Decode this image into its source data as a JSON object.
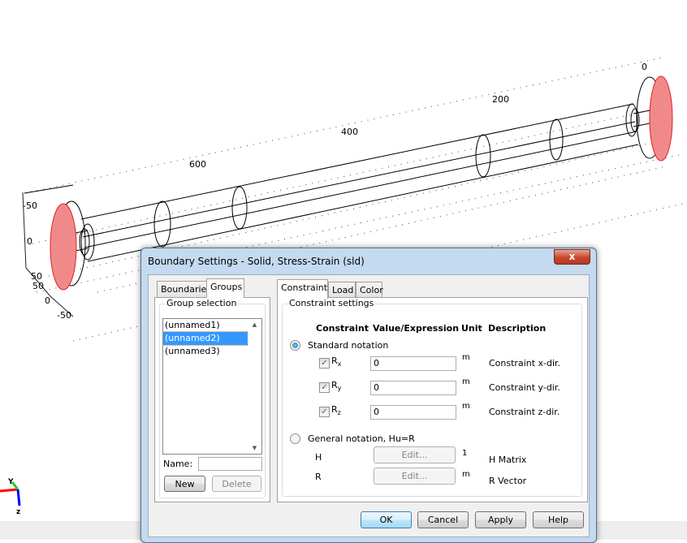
{
  "scene": {
    "axis_labels_top": [
      "0",
      "200",
      "400",
      "600"
    ],
    "axis_labels_left": [
      "-50",
      "0",
      "50",
      "50",
      "0",
      "-50"
    ],
    "triad": {
      "y_label": "Y",
      "z_label": "z"
    },
    "highlight_color": "#f08080"
  },
  "dialog": {
    "title": "Boundary Settings - Solid, Stress-Strain (sld)",
    "close_label": "x",
    "left_tabs": [
      "Boundaries",
      "Groups"
    ],
    "active_left_tab": "Groups",
    "group_selection": {
      "legend": "Group selection",
      "items": [
        "(unnamed1)",
        "(unnamed2)",
        "(unnamed3)"
      ],
      "selected": "(unnamed2)",
      "name_label": "Name:",
      "name_value": "",
      "new_label": "New",
      "delete_label": "Delete"
    },
    "right_tabs": [
      "Constraint",
      "Load",
      "Color"
    ],
    "active_right_tab": "Constraint",
    "constraint": {
      "legend": "Constraint settings",
      "headers": [
        "Constraint",
        "Value/Expression",
        "Unit",
        "Description"
      ],
      "standard_label": "Standard notation",
      "standard_selected": true,
      "rows": [
        {
          "sym": "R",
          "sub": "x",
          "checked": true,
          "value": "0",
          "unit": "m",
          "desc": "Constraint x-dir."
        },
        {
          "sym": "R",
          "sub": "y",
          "checked": true,
          "value": "0",
          "unit": "m",
          "desc": "Constraint y-dir."
        },
        {
          "sym": "R",
          "sub": "z",
          "checked": true,
          "value": "0",
          "unit": "m",
          "desc": "Constraint z-dir."
        }
      ],
      "general_label": "General notation, Hu=R",
      "matrix_rows": [
        {
          "sym": "H",
          "button": "Edit...",
          "unit": "1",
          "desc": "H Matrix"
        },
        {
          "sym": "R",
          "button": "Edit...",
          "unit": "m",
          "desc": "R Vector"
        }
      ]
    },
    "buttons": {
      "ok": "OK",
      "cancel": "Cancel",
      "apply": "Apply",
      "help": "Help"
    }
  }
}
